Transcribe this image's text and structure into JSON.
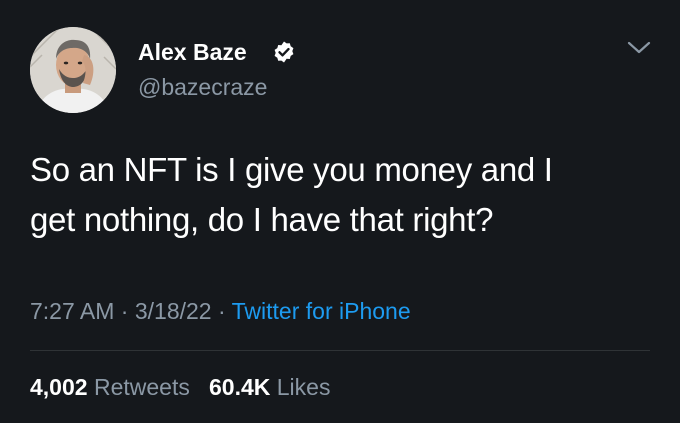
{
  "author": {
    "display_name": "Alex Baze",
    "handle": "@bazecraze",
    "avatar_icon": "profile-photo",
    "verified_icon": "verified-badge-icon"
  },
  "menu_icon": "chevron-down-icon",
  "tweet": {
    "text_line1": "So an NFT is I give you money and I",
    "text_line2": "get nothing, do I have that right?"
  },
  "meta": {
    "time": "7:27 AM",
    "separator": "·",
    "date": "3/18/22",
    "source": "Twitter for iPhone"
  },
  "stats": {
    "retweets_count": "4,002",
    "retweets_label": "Retweets",
    "likes_count": "60.4K",
    "likes_label": "Likes"
  },
  "colors": {
    "background": "#15181c",
    "primary_text": "#ffffff",
    "secondary_text": "#8b98a5",
    "link": "#1d9bf0",
    "divider": "#2f3336"
  }
}
